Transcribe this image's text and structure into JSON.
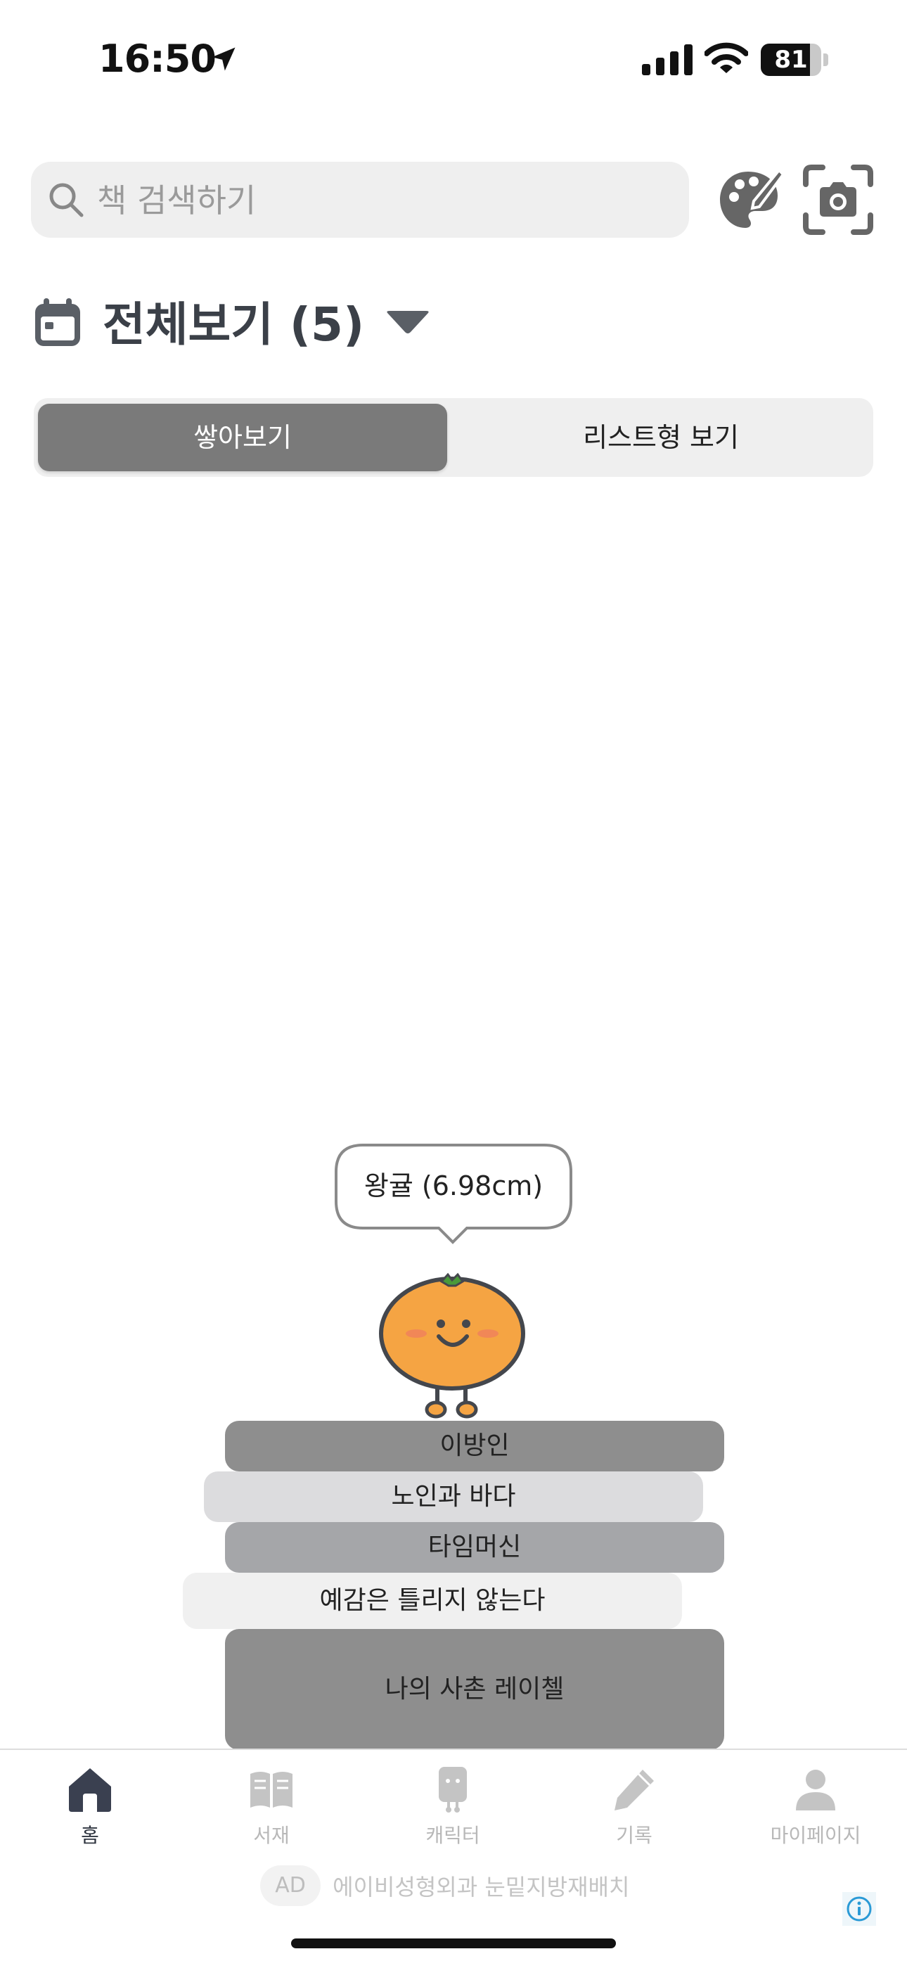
{
  "status_bar": {
    "time": "16:50",
    "battery": "81",
    "battery_level": 0.81
  },
  "search": {
    "placeholder": "책 검색하기"
  },
  "header": {
    "title": "전체보기 (5)"
  },
  "view_toggle": {
    "options": [
      "쌓아보기",
      "리스트형 보기"
    ],
    "selected": "쌓아보기"
  },
  "character": {
    "caption": "왕귤 (6.98cm)",
    "icon": "tangerine-character"
  },
  "books": [
    {
      "title": "이방인",
      "color": "#8e8e8e"
    },
    {
      "title": "노인과 바다",
      "color": "#dcdcde"
    },
    {
      "title": "타임머신",
      "color": "#a5a6a9"
    },
    {
      "title": "예감은 틀리지 않는다",
      "color": "#f0f0f0"
    },
    {
      "title": "나의 사촌 레이첼",
      "color": "#8e8e8e"
    }
  ],
  "tabbar": {
    "items": [
      {
        "label": "홈",
        "icon": "home-icon",
        "active": true
      },
      {
        "label": "서재",
        "icon": "book-open-icon",
        "active": false
      },
      {
        "label": "캐릭터",
        "icon": "character-icon",
        "active": false
      },
      {
        "label": "기록",
        "icon": "pencil-icon",
        "active": false
      },
      {
        "label": "마이페이지",
        "icon": "person-icon",
        "active": false
      }
    ]
  },
  "ad": {
    "badge": "AD",
    "text": "에이비성형외과 눈밑지방재배치"
  },
  "colors": {
    "accent": "#7a7a7a",
    "title": "#3b4048",
    "tangerine": "#f5a443"
  }
}
